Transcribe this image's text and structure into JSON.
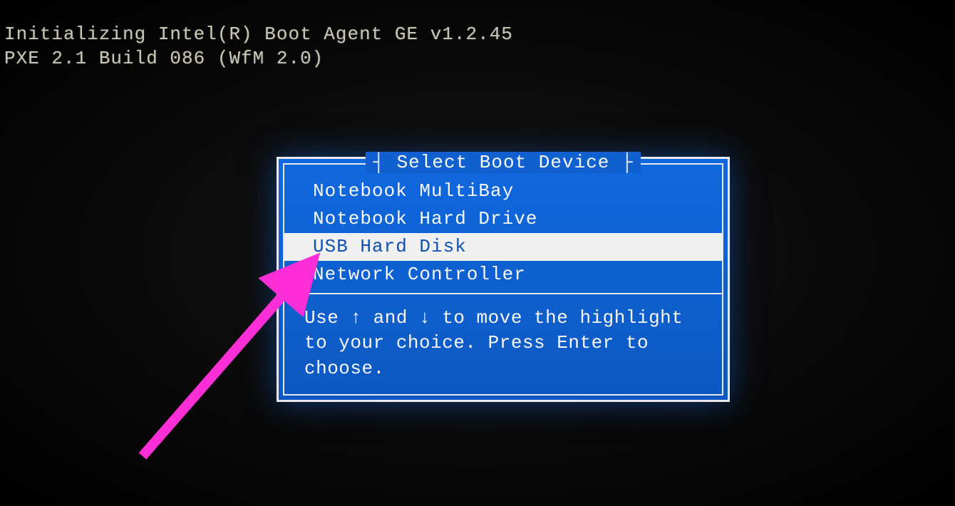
{
  "bios": {
    "line1": "Initializing Intel(R) Boot Agent GE v1.2.45",
    "line2": "PXE 2.1 Build 086 (WfM 2.0)"
  },
  "dialog": {
    "title": "Select Boot Device",
    "items": [
      {
        "label": "Notebook MultiBay",
        "selected": false
      },
      {
        "label": "Notebook Hard Drive",
        "selected": false
      },
      {
        "label": "USB Hard Disk",
        "selected": true
      },
      {
        "label": "Network Controller",
        "selected": false
      }
    ],
    "help": "Use ↑ and ↓ to move the highlight to your choice.  Press Enter to choose."
  },
  "annotation": {
    "arrow_color": "#ff2ed6"
  }
}
